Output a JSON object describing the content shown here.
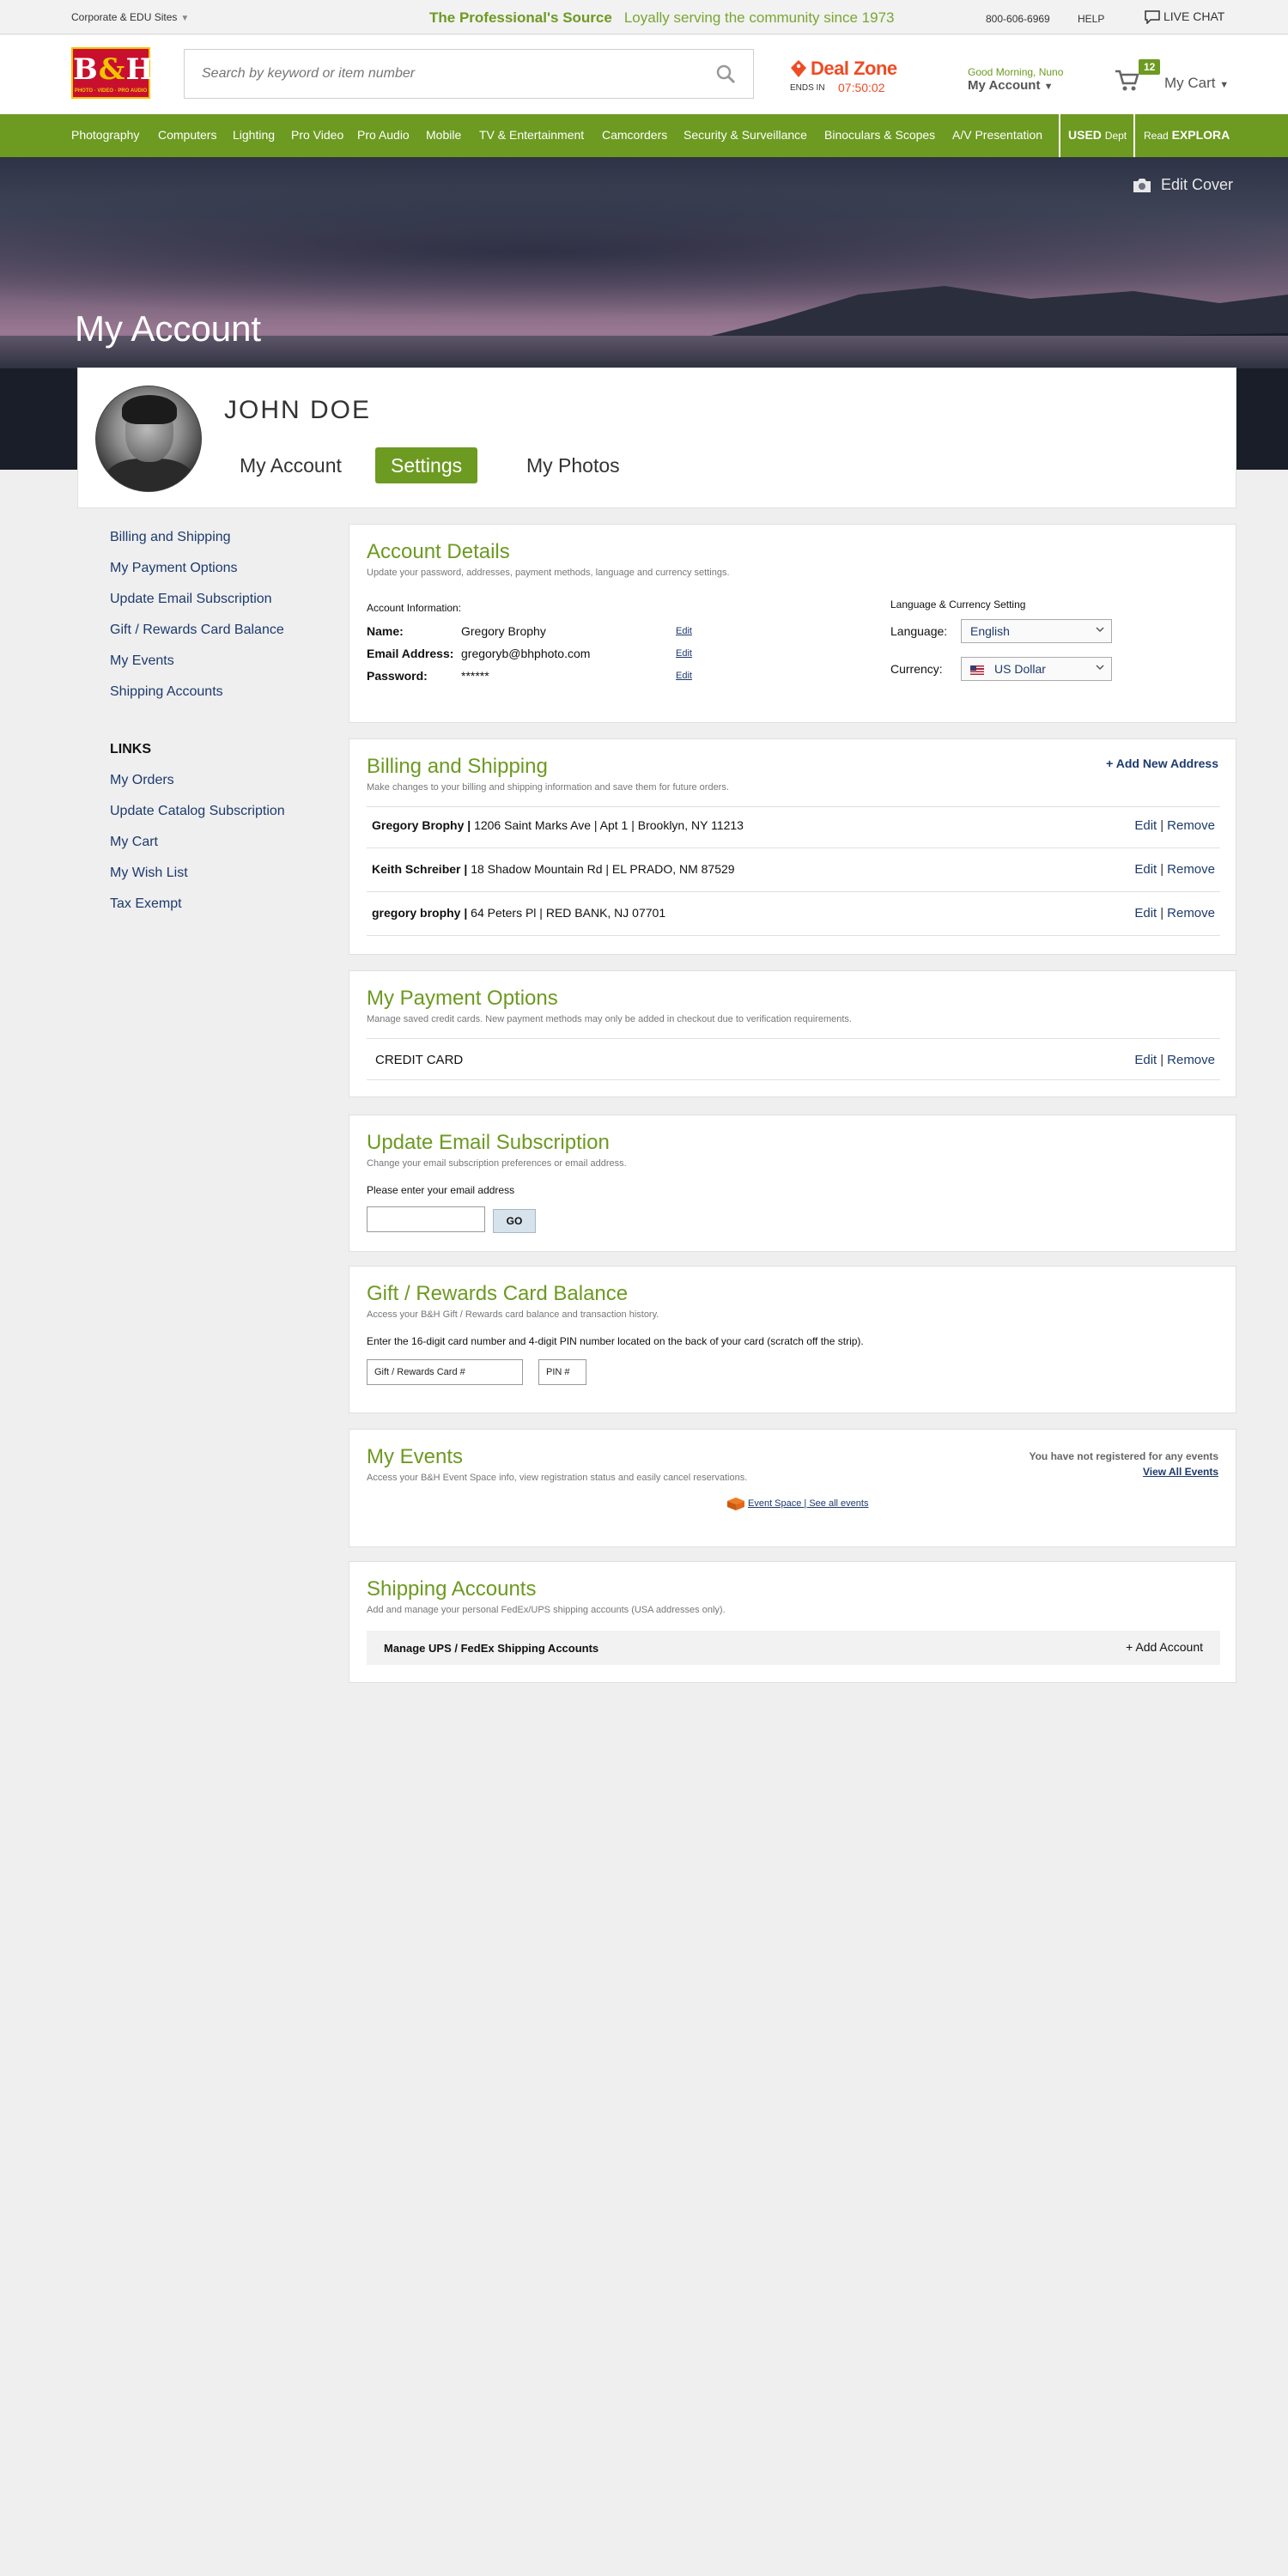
{
  "util": {
    "corporate": "Corporate & EDU Sites",
    "tagline_bold": "The Professional's Source",
    "tagline_rest": "Loyally serving the community since 1973",
    "phone": "800-606-6969",
    "help": "HELP",
    "live_chat": "LIVE CHAT"
  },
  "header": {
    "logo_text": "B&H",
    "logo_sub": "PHOTO · VIDEO · PRO AUDIO",
    "search_placeholder": "Search by keyword or item number",
    "deal_zone": "Deal Zone",
    "ends_in": "ENDS IN",
    "deal_timer": "07:50:02",
    "greeting": "Good Morning, Nuno",
    "my_account": "My Account",
    "cart_count": "12",
    "my_cart": "My Cart"
  },
  "nav": {
    "items": [
      "Photography",
      "Computers",
      "Lighting",
      "Pro Video",
      "Pro Audio",
      "Mobile",
      "TV & Entertainment",
      "Camcorders",
      "Security & Surveillance",
      "Binoculars & Scopes",
      "A/V Presentation"
    ],
    "used_bold": "USED",
    "used_rest": "Dept",
    "explora_pre": "Read",
    "explora": "EXPLORA"
  },
  "cover": {
    "edit_cover": "Edit Cover",
    "title": "My Account"
  },
  "profile": {
    "name": "JOHN DOE",
    "tabs": [
      "My Account",
      "Settings",
      "My Photos"
    ],
    "active_tab": "Settings"
  },
  "sidebar": {
    "links": [
      "Billing and Shipping",
      "My Payment Options",
      "Update Email Subscription",
      "Gift / Rewards Card Balance",
      "My Events",
      "Shipping Accounts"
    ],
    "links_header": "LINKS",
    "links2": [
      "My Orders",
      "Update Catalog Subscription",
      "My Cart",
      "My Wish List",
      "Tax Exempt"
    ]
  },
  "account": {
    "title": "Account Details",
    "subtitle": "Update your password, addresses, payment methods, language and currency settings.",
    "info_label": "Account Information:",
    "name_label": "Name:",
    "name_value": "Gregory Brophy",
    "email_label": "Email Address:",
    "email_value": "gregoryb@bhphoto.com",
    "password_label": "Password:",
    "password_value": "******",
    "edit": "Edit",
    "lang_header": "Language & Currency Setting",
    "language_label": "Language:",
    "language_value": "English",
    "currency_label": "Currency:",
    "currency_value": "US Dollar"
  },
  "billing": {
    "title": "Billing and Shipping",
    "subtitle": "Make changes to your billing and shipping information and save them for future orders.",
    "add_new": "+ Add New Address",
    "addresses": [
      {
        "name": "Gregory Brophy |",
        "address": "1206 Saint Marks Ave | Apt 1 | Brooklyn, NY 11213"
      },
      {
        "name": "Keith Schreiber |",
        "address": "18 Shadow Mountain Rd | EL PRADO, NM 87529"
      },
      {
        "name": "gregory brophy |",
        "address": "64 Peters Pl | RED BANK, NJ 07701"
      }
    ],
    "edit": "Edit",
    "remove": "Remove"
  },
  "payment": {
    "title": "My Payment Options",
    "subtitle": "Manage saved credit cards. New payment methods may only be added in checkout due to verification requirements.",
    "credit_card": "CREDIT CARD",
    "edit": "Edit",
    "remove": "Remove"
  },
  "email": {
    "title": "Update Email Subscription",
    "subtitle": "Change your email subscription preferences or email address.",
    "prompt": "Please enter your email address",
    "go": "GO"
  },
  "gift": {
    "title": "Gift / Rewards Card Balance",
    "subtitle": "Access your B&H Gift / Rewards card balance and transaction history.",
    "description": "Enter the 16-digit card number and 4-digit PIN number located on the back of your card (scratch off the strip).",
    "card_placeholder": "Gift / Rewards Card #",
    "pin_placeholder": "PIN #"
  },
  "events": {
    "title": "My Events",
    "subtitle": "Access your B&H Event Space info, view registration status and easily cancel reservations.",
    "not_registered": "You have not registered for any events",
    "view_all": "View All Events",
    "event_space": "Event Space | See all events"
  },
  "shipping": {
    "title": "Shipping Accounts",
    "subtitle": "Add and manage your personal FedEx/UPS shipping accounts (USA addresses only).",
    "manage": "Manage UPS / FedEx Shipping Accounts",
    "add": "+ Add Account"
  }
}
